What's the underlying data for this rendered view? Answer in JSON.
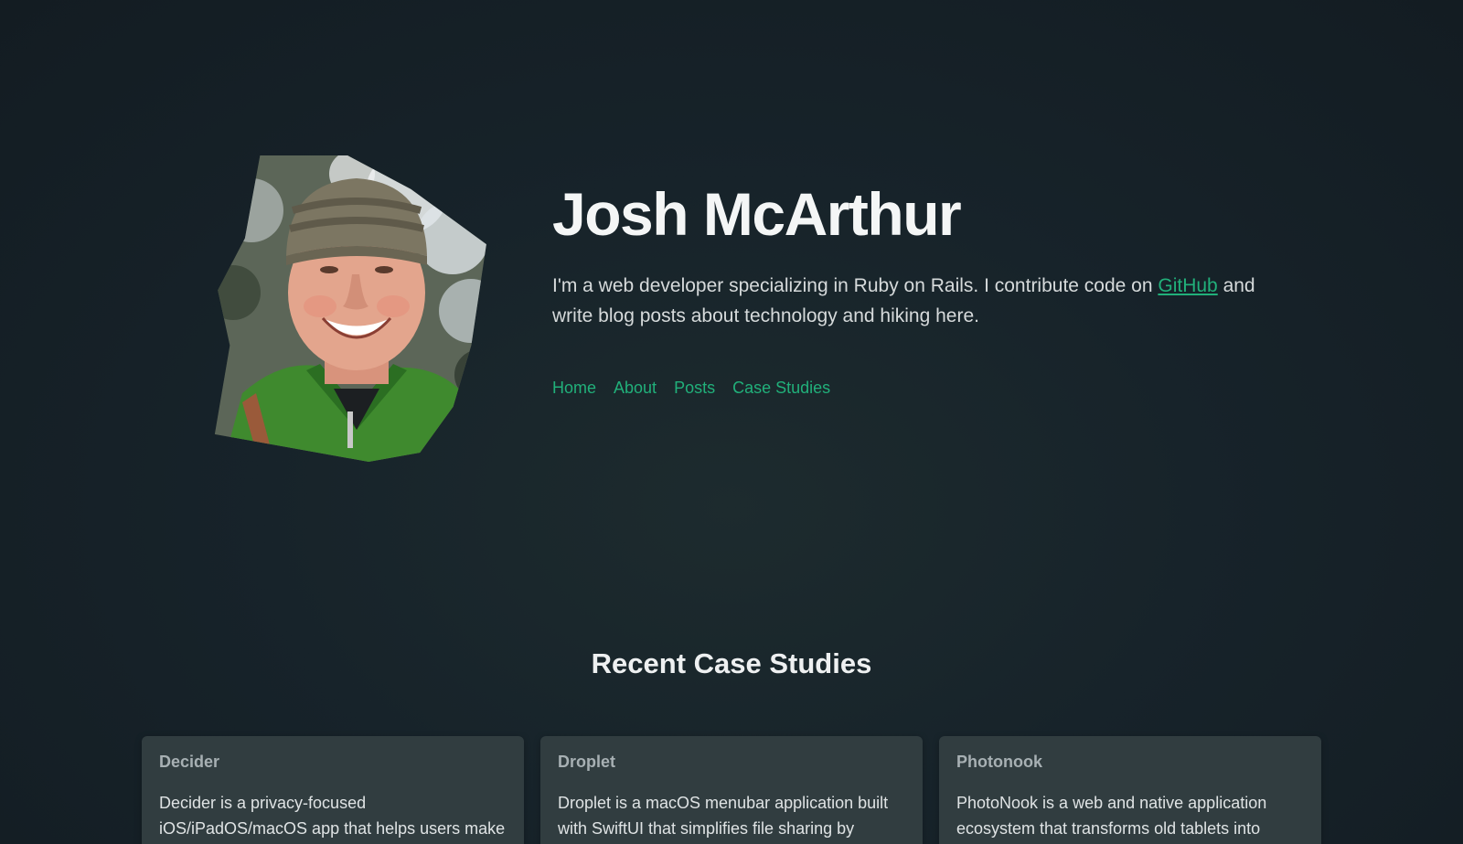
{
  "hero": {
    "title": "Josh McArthur",
    "intro_before_link": "I'm a web developer specializing in Ruby on Rails. I contribute code on ",
    "intro_link": "GitHub",
    "intro_after_link": " and write blog posts about technology and hiking here.",
    "portrait_icon": "profile-photo"
  },
  "nav": {
    "items": [
      {
        "label": "Home"
      },
      {
        "label": "About"
      },
      {
        "label": "Posts"
      },
      {
        "label": "Case Studies"
      }
    ]
  },
  "case_studies": {
    "heading": "Recent Case Studies",
    "items": [
      {
        "title": "Decider",
        "description": "Decider is a privacy-focused iOS/iPadOS/macOS app that helps users make"
      },
      {
        "title": "Droplet",
        "description": "Droplet is a macOS menubar application built with SwiftUI that simplifies file sharing by"
      },
      {
        "title": "Photonook",
        "description": "PhotoNook is a web and native application ecosystem that transforms old tablets into"
      }
    ]
  },
  "colors": {
    "accent": "#21b07a",
    "background": "#17232a",
    "card": "#313d40"
  }
}
